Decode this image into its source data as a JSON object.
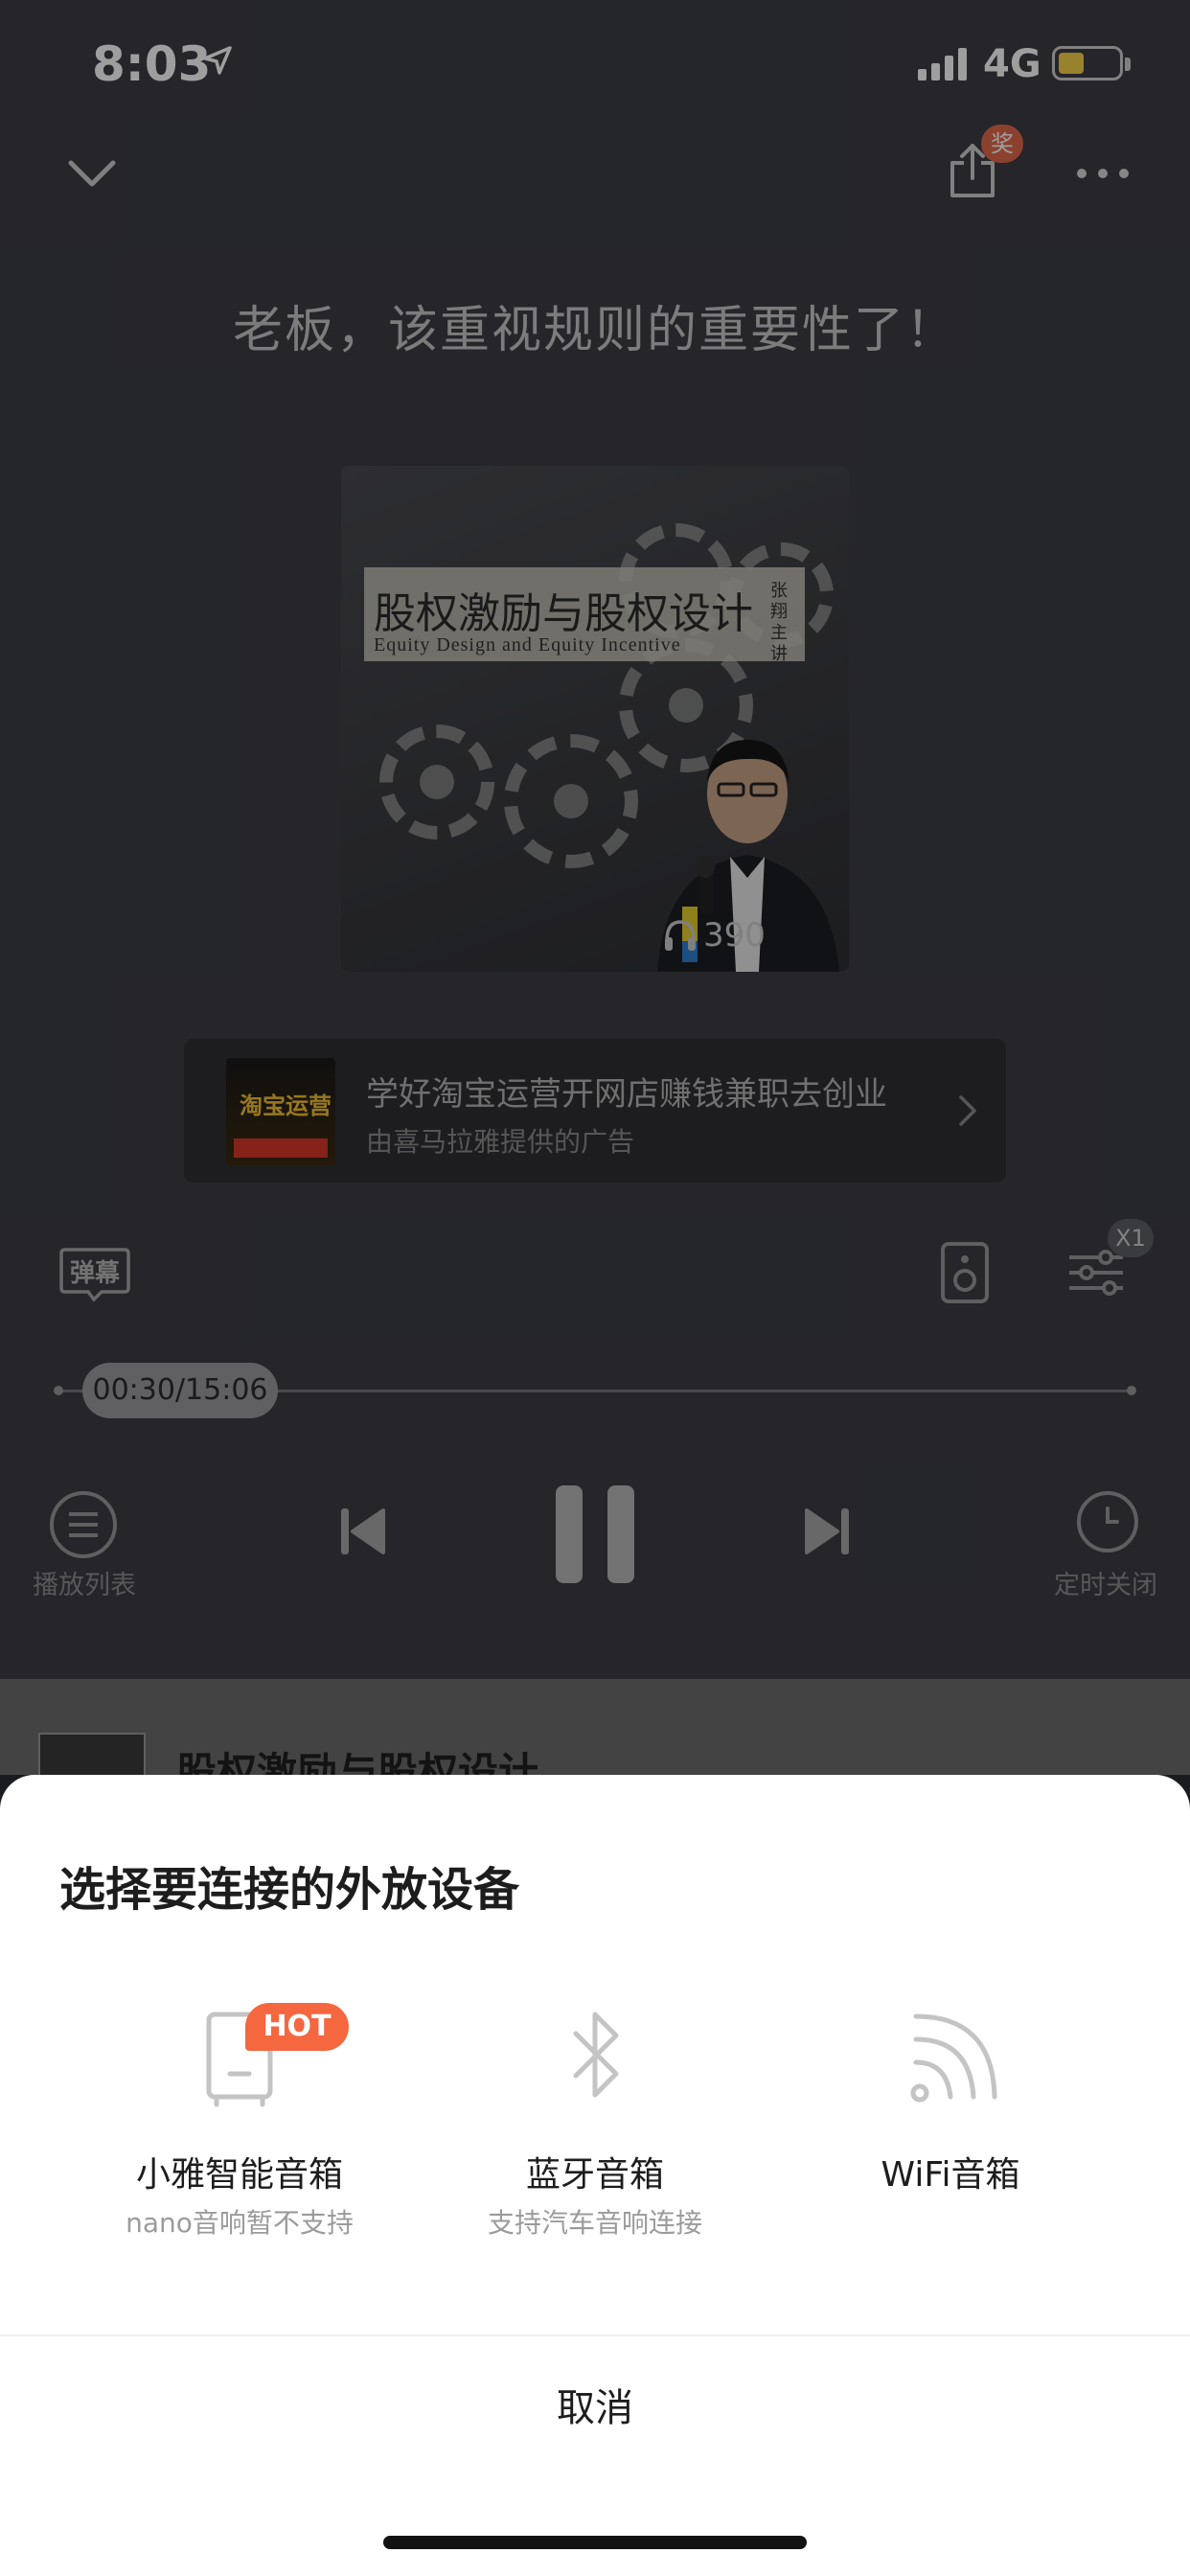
{
  "status_bar": {
    "time": "8:03",
    "network": "4G"
  },
  "header": {
    "award_badge": "奖"
  },
  "track": {
    "title": "老板，该重视规则的重要性了！"
  },
  "cover": {
    "title": "股权激励与股权设计",
    "subtitle": "Equity Design and Equity Incentive",
    "author": "张翔主讲",
    "play_count": "390"
  },
  "ad": {
    "title": "学好淘宝运营开网店赚钱兼职去创业",
    "subtitle": "由喜马拉雅提供的广告",
    "thumb_text": "淘宝运营"
  },
  "controls": {
    "danmu_label": "弹幕",
    "speed_label": "X1",
    "time_display": "00:30/15:06",
    "progress": 0.033,
    "playlist_label": "播放列表",
    "timer_label": "定时关闭"
  },
  "mini_player": {
    "title": "股权激励与股权设计"
  },
  "sheet": {
    "title": "选择要连接的外放设备",
    "options": [
      {
        "label": "小雅智能音箱",
        "sub": "nano音响暂不支持",
        "badge": "HOT",
        "icon": "smart-speaker-icon"
      },
      {
        "label": "蓝牙音箱",
        "sub": "支持汽车音响连接",
        "icon": "bluetooth-icon"
      },
      {
        "label": "WiFi音箱",
        "sub": "",
        "icon": "wifi-icon"
      }
    ],
    "cancel_label": "取消"
  },
  "colors": {
    "hot": "#f4673f",
    "award": "#e2694c",
    "battery": "#f7d24a",
    "sheet_bg": "#ffffff",
    "player_bg": "#3c3d44"
  }
}
